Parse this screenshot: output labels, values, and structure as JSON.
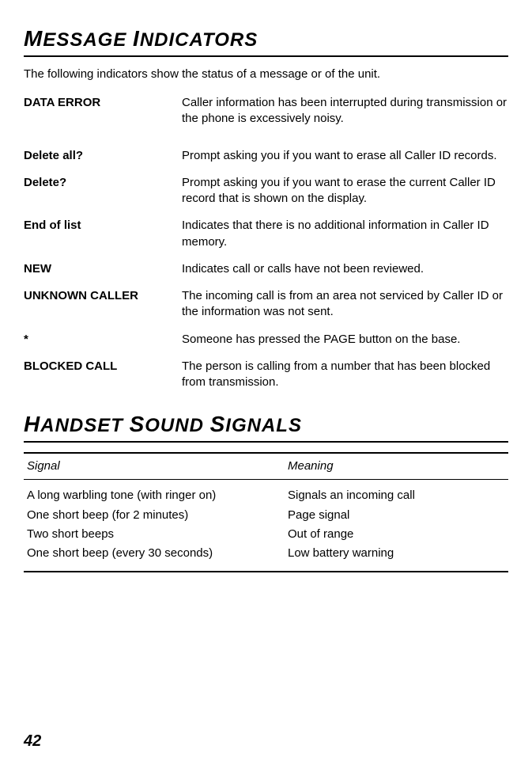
{
  "section1": {
    "title_html": "M<small>ESSAGE</small> I<small>NDICATORS</small>",
    "intro": "The following indicators show the status of a message or of the unit.",
    "items": [
      {
        "term": "DATA ERROR",
        "desc": "Caller information has been interrupted during transmission or the phone is excessively noisy."
      },
      {
        "term": "Delete all?",
        "desc": "Prompt asking you if you want to erase all Caller ID records."
      },
      {
        "term": "Delete?",
        "desc": "Prompt asking you if you want to erase the current Caller ID record that is shown on the display."
      },
      {
        "term": "End of list",
        "desc": "Indicates that there is no additional information in Caller ID memory."
      },
      {
        "term": "NEW",
        "desc": "Indicates call or calls have not been reviewed."
      },
      {
        "term": "UNKNOWN CALLER",
        "desc": "The incoming call is from an area not serviced by Caller ID or the information was not sent."
      },
      {
        "term": "*",
        "desc": "Someone has pressed the PAGE button on the base."
      },
      {
        "term": "BLOCKED CALL",
        "desc": "The person is calling from a number that has been blocked from transmission."
      }
    ]
  },
  "section2": {
    "title_html": "H<small>ANDSET</small> S<small>OUND</small> S<small>IGNALS</small>",
    "headers": {
      "signal": "Signal",
      "meaning": "Meaning"
    },
    "rows": [
      {
        "signal": "A long warbling tone (with ringer on)",
        "meaning": "Signals an incoming call"
      },
      {
        "signal": "One short beep (for 2 minutes)",
        "meaning": "Page signal"
      },
      {
        "signal": "Two short beeps",
        "meaning": "Out of range"
      },
      {
        "signal": "One short beep (every 30 seconds)",
        "meaning": "Low battery warning"
      }
    ]
  },
  "page_number": "42"
}
